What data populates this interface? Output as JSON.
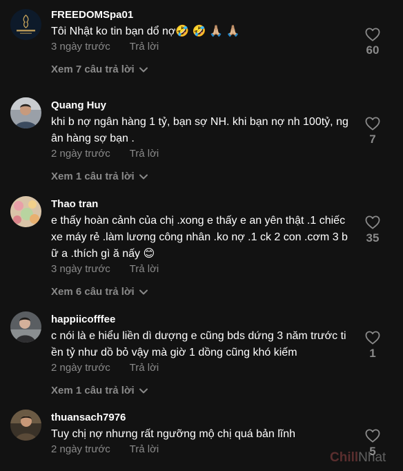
{
  "comments": [
    {
      "username": "FREEDOMSpa01",
      "text": "Tôi Nhật ko tin bạn dổ nợ🤣 🤣 🙏🏼 🙏🏼",
      "time": "3 ngày trước",
      "reply": "Trả lời",
      "view_replies": "Xem 7 câu trả lời",
      "likes": "60",
      "avatar_text": "FREEDOM SPA"
    },
    {
      "username": "Quang Huy",
      "text": "khi b nợ ngân hàng 1 tỷ, bạn sợ NH. khi bạn nợ nh 100tỷ, ng ân hàng sợ bạn .",
      "time": "2 ngày trước",
      "reply": "Trả lời",
      "view_replies": "Xem 1 câu trả lời",
      "likes": "7"
    },
    {
      "username": "Thao tran",
      "text": "e thấy hoàn cảnh của chị .xong e thấy e an yên thật .1 chiếc xe máy rẻ .làm lương công nhân .ko nợ .1 ck 2 con .cơm 3 bữ a .thích gì ă nấy 😊",
      "time": "3 ngày trước",
      "reply": "Trả lời",
      "view_replies": "Xem 6 câu trả lời",
      "likes": "35"
    },
    {
      "username": "happiicofffee",
      "text": "c nói là e hiểu liền dì dượng e cũng bds dứng 3 năm trước ti ền tỷ như dồ bỏ vậy mà giờ 1 dồng cũng khó kiếm",
      "time": "2 ngày trước",
      "reply": "Trả lời",
      "view_replies": "Xem 1 câu trả lời",
      "likes": "1"
    },
    {
      "username": "thuansach7976",
      "text": "Tuy chị nợ nhưng rất ngưỡng mộ chị quá bản lĩnh",
      "time": "2 ngày trước",
      "reply": "Trả lời",
      "likes": "5"
    }
  ],
  "watermark": {
    "part1": "Chill",
    "part2": "Nhat"
  },
  "colors": {
    "background": "#121212",
    "muted": "#8a8a8a",
    "text": "#ffffff"
  }
}
